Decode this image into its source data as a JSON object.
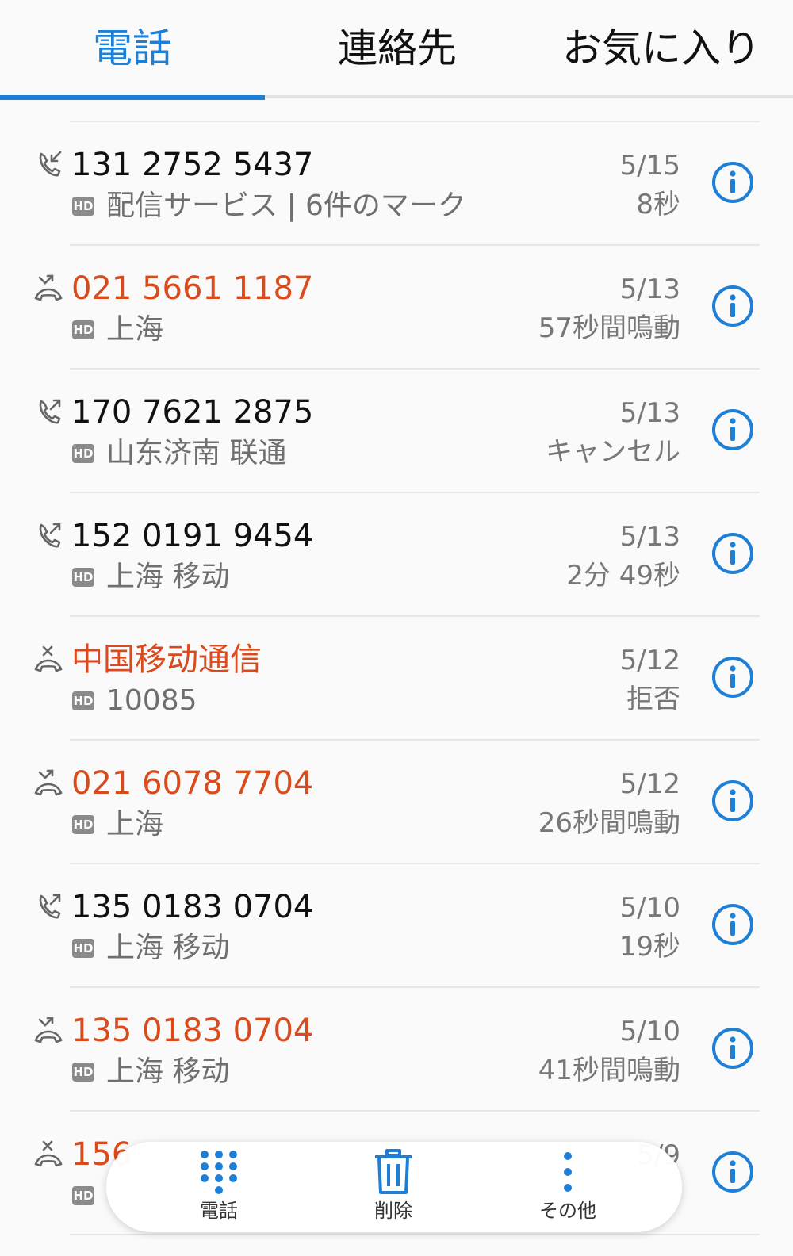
{
  "tabs": [
    {
      "label": "電話",
      "active": true
    },
    {
      "label": "連絡先",
      "active": false
    },
    {
      "label": "お気に入り",
      "active": false
    }
  ],
  "colors": {
    "accent": "#1e7fd6",
    "missed": "#d94b1c"
  },
  "calls": [
    {
      "type": "incoming",
      "name": "131 2752 5437",
      "hd": "HD",
      "subtitle": "配信サービス | 6件のマーク",
      "date": "5/15",
      "detail": "8秒"
    },
    {
      "type": "missed",
      "name": "021 5661 1187",
      "hd": "HD",
      "subtitle": "上海",
      "date": "5/13",
      "detail": "57秒間鳴動"
    },
    {
      "type": "outgoing",
      "name": "170 7621 2875",
      "hd": "HD",
      "subtitle": "山东济南 联通",
      "date": "5/13",
      "detail": "キャンセル"
    },
    {
      "type": "outgoing",
      "name": "152 0191 9454",
      "hd": "HD",
      "subtitle": "上海 移动",
      "date": "5/13",
      "detail": "2分 49秒"
    },
    {
      "type": "rejected",
      "name": "中国移动通信",
      "hd": "HD",
      "subtitle": "10085",
      "date": "5/12",
      "detail": "拒否"
    },
    {
      "type": "missed",
      "name": "021 6078 7704",
      "hd": "HD",
      "subtitle": "上海",
      "date": "5/12",
      "detail": "26秒間鳴動"
    },
    {
      "type": "outgoing",
      "name": "135 0183 0704",
      "hd": "HD",
      "subtitle": "上海 移动",
      "date": "5/10",
      "detail": "19秒"
    },
    {
      "type": "missed",
      "name": "135 0183 0704",
      "hd": "HD",
      "subtitle": "上海 移动",
      "date": "5/10",
      "detail": "41秒間鳴動"
    },
    {
      "type": "rejected",
      "name": "156",
      "hd": "HD",
      "subtitle": "",
      "date": "5/9",
      "detail": ""
    }
  ],
  "bottom_bar": {
    "dialpad_label": "電話",
    "delete_label": "削除",
    "more_label": "その他"
  },
  "icons": {
    "incoming": "incoming-call-icon",
    "outgoing": "outgoing-call-icon",
    "missed": "missed-call-icon",
    "rejected": "rejected-call-icon",
    "info": "info-icon"
  }
}
